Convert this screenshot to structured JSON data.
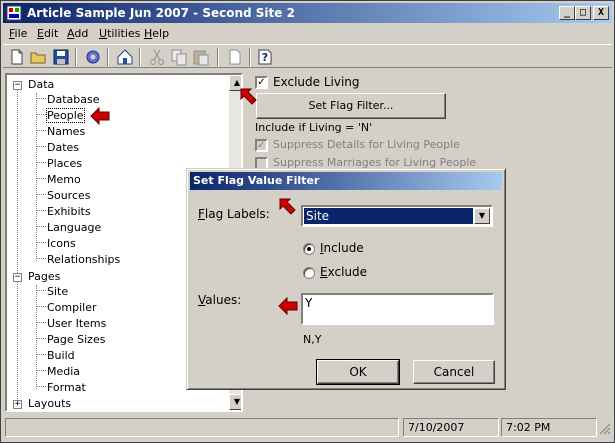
{
  "window": {
    "title": "Article Sample Jun 2007 - Second Site 2",
    "controls": {
      "minimize": "_",
      "maximize": "□",
      "close": "X"
    }
  },
  "menu": [
    {
      "label": "File",
      "accel": "F"
    },
    {
      "label": "Edit",
      "accel": "E"
    },
    {
      "label": "Add",
      "accel": "A"
    },
    {
      "label": "Utilities",
      "accel": "U"
    },
    {
      "label": "Help",
      "accel": "H"
    }
  ],
  "toolbar": {
    "icons": [
      "new-icon",
      "open-icon",
      "save-icon",
      "settings-icon",
      "home-icon",
      "cut-icon",
      "copy-icon",
      "paste-icon",
      "page-icon",
      "help-icon"
    ]
  },
  "tree": {
    "groups": [
      {
        "label": "Data",
        "expanded": true,
        "children": [
          "Database",
          "People",
          "Names",
          "Dates",
          "Places",
          "Memo",
          "Sources",
          "Exhibits",
          "Language",
          "Icons",
          "Relationships"
        ]
      },
      {
        "label": "Pages",
        "expanded": true,
        "children": [
          "Site",
          "Compiler",
          "User Items",
          "Page Sizes",
          "Build",
          "Media",
          "Format"
        ]
      },
      {
        "label": "Layouts",
        "expanded": false,
        "children": []
      }
    ],
    "selected": "People",
    "collapse_glyph": "−",
    "expand_glyph": "+",
    "scroll_up": "▲",
    "scroll_down": "▼"
  },
  "panel": {
    "exclude_living_label": "Exclude Living",
    "exclude_living_checked": true,
    "set_flag_filter_button": "Set Flag Filter...",
    "include_if_text": "Include if  Living = 'N'",
    "suppress_details_label": "Suppress Details for Living People",
    "suppress_marriages_label": "Suppress Marriages for Living People",
    "check_glyph": "✓"
  },
  "dialog": {
    "title": "Set Flag Value Filter",
    "flag_labels_label": "Flag Labels:",
    "flag_labels_accel": "F",
    "flag_labels_value": "Site",
    "include_label": "Include",
    "include_accel": "I",
    "exclude_label": "Exclude",
    "exclude_accel": "E",
    "include_selected": true,
    "values_label": "Values:",
    "values_accel": "V",
    "values_input": "Y",
    "values_hint": "N,Y",
    "ok_button": "OK",
    "cancel_button": "Cancel",
    "dropdown_glyph": "▼"
  },
  "statusbar": {
    "date": "7/10/2007",
    "time": "7:02 PM"
  },
  "colors": {
    "titlebar_start": "#0a246a",
    "titlebar_end": "#a6caf0",
    "face": "#d4d0c8",
    "annotation_arrow": "#cc0000"
  }
}
